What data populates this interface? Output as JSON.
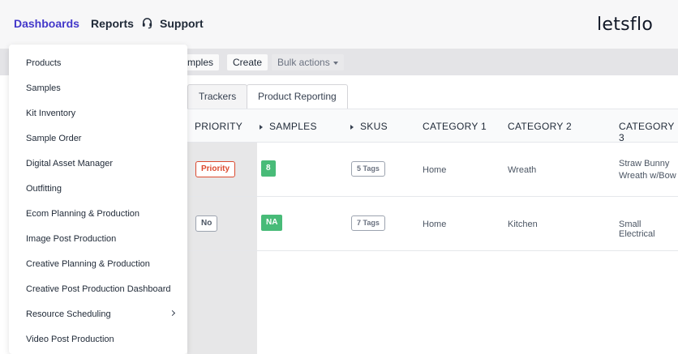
{
  "nav": {
    "dashboards": "Dashboards",
    "reports": "Reports",
    "support": "Support"
  },
  "brand": {
    "logo": "letsflo"
  },
  "toolbar": {
    "samples_partial": "mples",
    "create": "Create",
    "bulk_actions": "Bulk actions"
  },
  "tabs": [
    {
      "label": "Trackers"
    },
    {
      "label": "Product Reporting"
    }
  ],
  "table": {
    "headers": {
      "priority": "PRIORITY",
      "samples": "SAMPLES",
      "skus": "SKUS",
      "category1": "CATEGORY 1",
      "category2": "CATEGORY 2",
      "category3": "CATEGORY 3"
    },
    "rows": [
      {
        "priority": "Priority",
        "samples": "8",
        "skus": "5 Tags",
        "category1": "Home",
        "category2": "Wreath",
        "category3_line1": "Straw Bunny",
        "category3_line2": "Wreath w/Bow"
      },
      {
        "priority": "No",
        "samples": "NA",
        "skus": "7 Tags",
        "category1": "Home",
        "category2": "Kitchen",
        "category3_line1": "Small Electrical",
        "category3_line2": ""
      }
    ]
  },
  "dropdown": {
    "items": [
      {
        "label": "Products"
      },
      {
        "label": "Samples"
      },
      {
        "label": "Kit Inventory"
      },
      {
        "label": "Sample Order"
      },
      {
        "label": "Digital Asset Manager"
      },
      {
        "label": "Outfitting"
      },
      {
        "label": "Ecom Planning & Production"
      },
      {
        "label": "Image Post Production"
      },
      {
        "label": "Creative Planning & Production"
      },
      {
        "label": "Creative Post Production Dashboard"
      },
      {
        "label": "Resource Scheduling"
      },
      {
        "label": "Video Post Production"
      }
    ]
  },
  "colors": {
    "accent": "#4338ca",
    "priority_red": "#dc4a2f",
    "samples_green": "#48bb78"
  },
  "icons": {
    "support": "headset-icon",
    "submenu": "chevron-right-icon",
    "bulk": "caret-down-icon",
    "sort": "sort-arrow-icon"
  }
}
